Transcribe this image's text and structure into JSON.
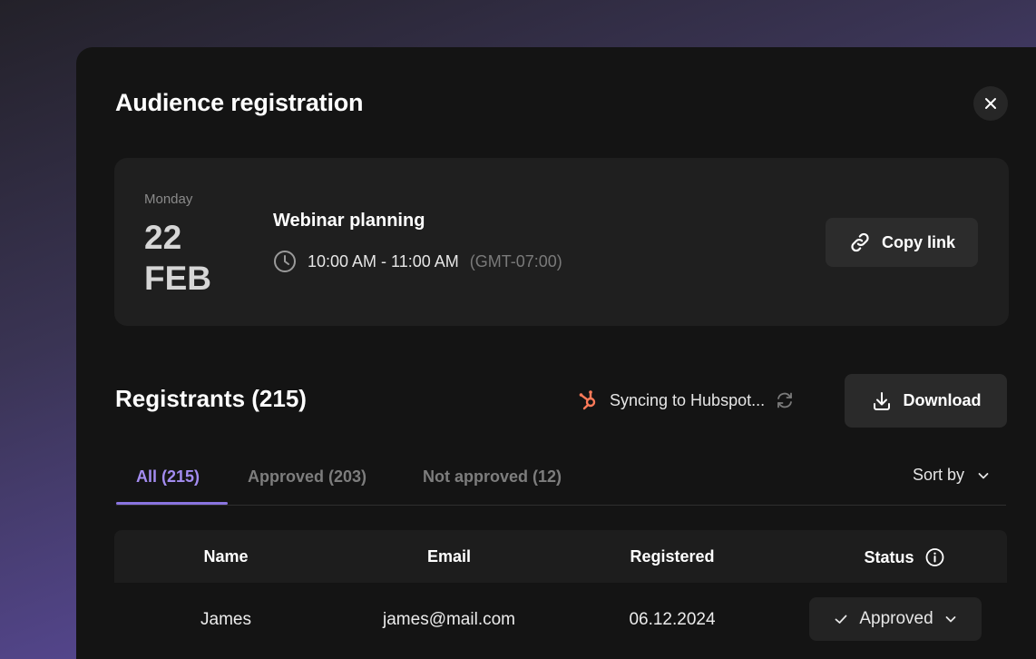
{
  "dialog": {
    "title": "Audience registration"
  },
  "event": {
    "day": "Monday",
    "date_num": "22",
    "month": "FEB",
    "name": "Webinar planning",
    "time": "10:00 AM - 11:00 AM",
    "timezone": "(GMT-07:00)",
    "copy_label": "Copy link"
  },
  "registrants": {
    "title": "Registrants (215)",
    "sync_label": "Syncing to Hubspot...",
    "download_label": "Download",
    "tabs": [
      {
        "label": "All (215)",
        "active": true
      },
      {
        "label": "Approved (203)",
        "active": false
      },
      {
        "label": "Not approved (12)",
        "active": false
      }
    ],
    "sort_label": "Sort by",
    "columns": [
      "Name",
      "Email",
      "Registered",
      "Status"
    ],
    "rows": [
      {
        "name": "James",
        "email": "james@mail.com",
        "registered": "06.12.2024",
        "status": "Approved"
      }
    ]
  },
  "icons": {
    "close": "close-icon",
    "clock": "clock-icon",
    "link": "link-icon",
    "hubspot": "hubspot-icon",
    "refresh": "refresh-icon",
    "download": "download-icon",
    "chevron": "chevron-down-icon",
    "info": "info-icon",
    "check": "check-icon"
  },
  "colors": {
    "accent": "#a38cf0",
    "hubspot": "#ff7a59",
    "panel": "#141414"
  }
}
